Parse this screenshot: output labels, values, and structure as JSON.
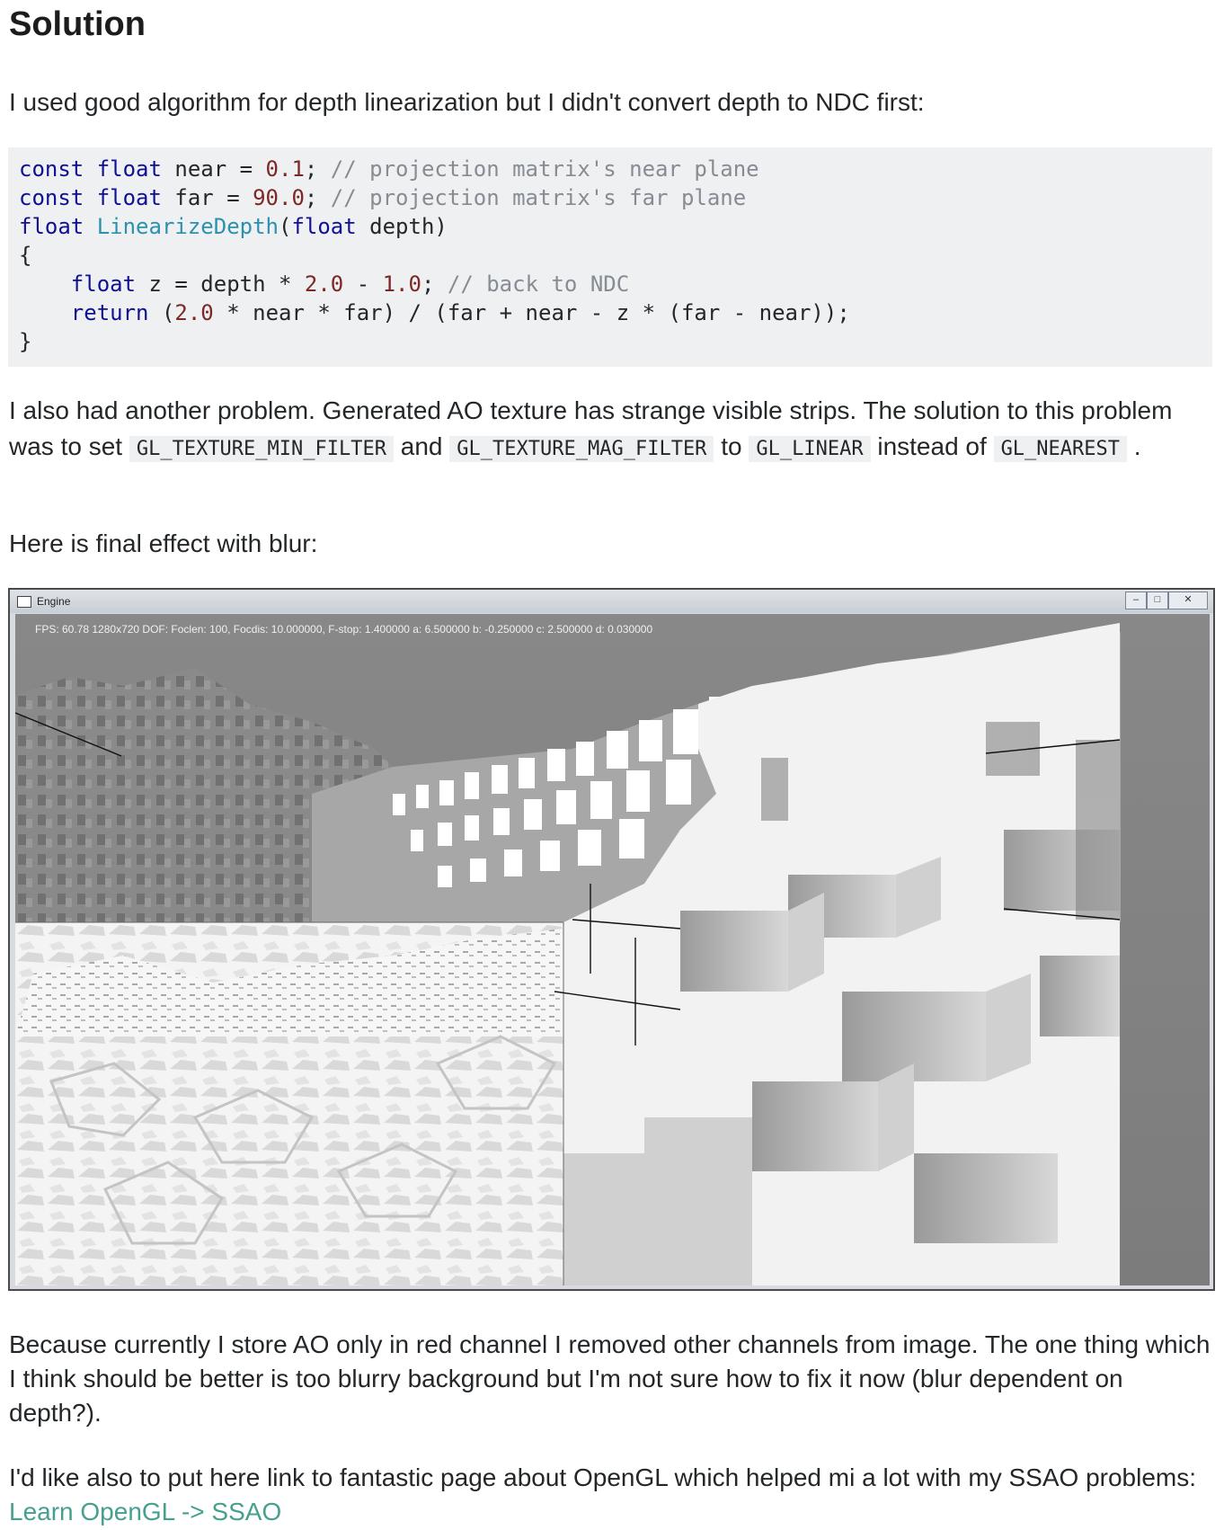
{
  "heading": "Solution",
  "intro": "I used good algorithm for depth linearization but I didn't convert depth to NDC first:",
  "code": {
    "l1_kw1": "const",
    "l1_kw2": "float",
    "l1_name": " near = ",
    "l1_num": "0.1",
    "l1_semi": ";",
    "l1_comment": " // projection matrix's near plane",
    "l2_kw1": "const",
    "l2_kw2": "float",
    "l2_name": " far = ",
    "l2_num": "90.0",
    "l2_semi": ";",
    "l2_comment": " // projection matrix's far plane",
    "l3_kw": "float",
    "l3_fn": "LinearizeDepth",
    "l3_open": "(",
    "l3_kw2": "float",
    "l3_rest": " depth)",
    "l4": "{",
    "l5_indent": "    ",
    "l5_kw": "float",
    "l5_mid": " z = depth * ",
    "l5_num1": "2.0",
    "l5_minus": " - ",
    "l5_num2": "1.0",
    "l5_semi": ";",
    "l5_comment": " // back to NDC",
    "l6_indent": "    ",
    "l6_kw": "return",
    "l6_open": " (",
    "l6_num": "2.0",
    "l6_rest": " * near * far) / (far + near - z * (far - near));",
    "l7": "}"
  },
  "para2": {
    "t1": "I also had another problem. Generated AO texture has strange visible strips. The solution to this problem was to set ",
    "c1": "GL_TEXTURE_MIN_FILTER",
    "t2": " and ",
    "c2": "GL_TEXTURE_MAG_FILTER",
    "t3": " to ",
    "c3": "GL_LINEAR",
    "t4": " instead of ",
    "c4": "GL_NEAREST",
    "t5": " ."
  },
  "para3": "Here is final effect with blur:",
  "screenshot": {
    "window_title": "Engine",
    "minimize": "–",
    "maximize": "□",
    "close": "✕",
    "fps_text": "FPS: 60.78 1280x720 DOF: Foclen: 100, Focdis: 10.000000, F-stop: 1.400000 a: 6.500000 b: -0.250000 c: 2.500000 d: 0.030000"
  },
  "para4": "Because currently I store AO only in red channel I removed other channels from image. The one thing which I think should be better is too blurry background but I'm not sure how to fix it now (blur dependent on depth?).",
  "para5": {
    "text": "I'd like also to put here link to fantastic page about OpenGL which helped mi a lot with my SSAO problems: ",
    "link": "Learn OpenGL -> SSAO"
  },
  "colors": {
    "keyword": "#101094",
    "function": "#2b91af",
    "number": "#7d2727",
    "comment": "#858c93",
    "link": "#45a08f",
    "code_bg": "#eff0f1"
  }
}
